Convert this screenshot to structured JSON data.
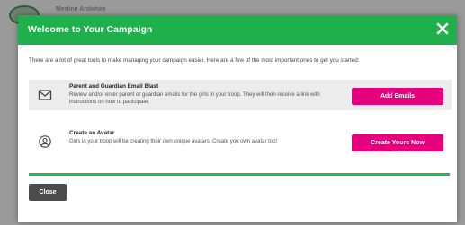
{
  "background": {
    "org_name": "Merline Ardwhee"
  },
  "modal": {
    "title": "Welcome to Your Campaign",
    "intro": "There are a lot of great tools to make managing your campaign easier. Here are a few of the most important ones to get you started:",
    "tools": [
      {
        "icon": "envelope-icon",
        "title": "Parent and Guardian Email Blast",
        "description": "Review and/or enter parent or guardian emails for the girls in your troop. They will then receive a link with instructions on how to participate.",
        "button_label": "Add Emails"
      },
      {
        "icon": "avatar-icon",
        "title": "Create an Avatar",
        "description": "Girls in your troop will be creating their own unique avatars. Create you own avatar too!",
        "button_label": "Create Yours Now"
      }
    ],
    "close_label": "Close"
  },
  "colors": {
    "header": "#1fb04b",
    "accent_button": "#e6007e",
    "close_button": "#4c4c4c",
    "divider": "#2bb457"
  }
}
